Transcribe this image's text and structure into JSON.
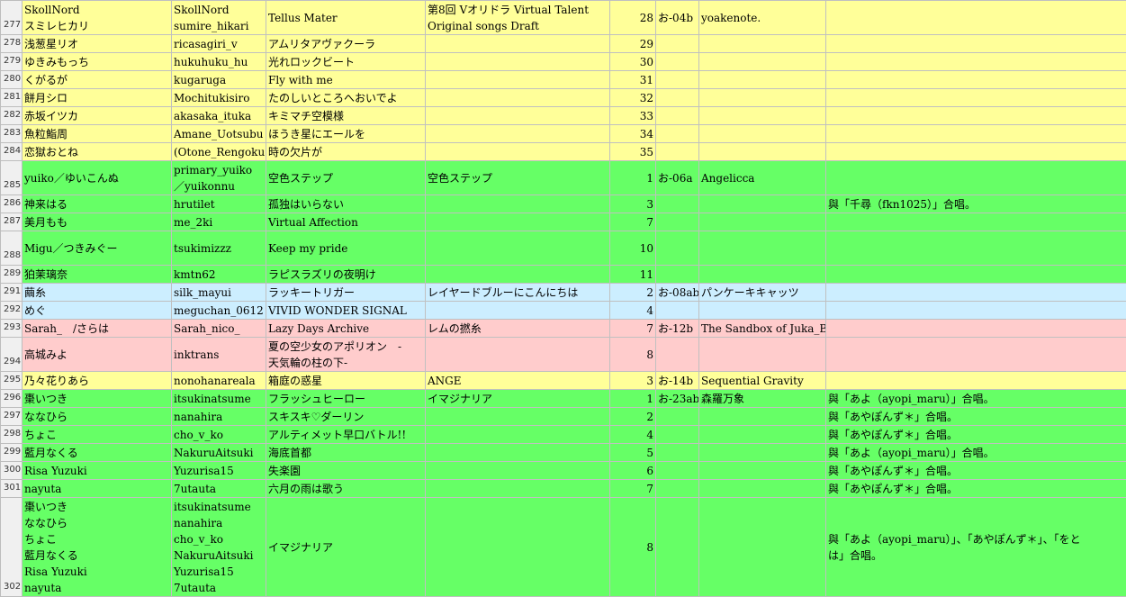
{
  "colors": {
    "yellow": "#ffff99",
    "green": "#66ff66",
    "blue": "#cceeff",
    "pink": "#ffcccc",
    "row_header": "#f0f0f0",
    "grid": "#c0c0c0"
  },
  "rows": [
    {
      "num": "277",
      "color": "yellow",
      "h": 36,
      "name": "SkollNord\nスミレヒカリ",
      "handle": "SkollNord\nsumire_hikari",
      "song": "Tellus Mater",
      "album": "第8回 Vオリドラ Virtual Talent\nOriginal songs Draft",
      "track": "28",
      "code": "お-04b",
      "circle": "yoakenote.",
      "note": ""
    },
    {
      "num": "278",
      "color": "yellow",
      "h": 18,
      "name": "浅葱星リオ",
      "handle": "ricasagiri_v",
      "song": "アムリタアヴァクーラ",
      "album": "",
      "track": "29",
      "code": "",
      "circle": "",
      "note": ""
    },
    {
      "num": "279",
      "color": "yellow",
      "h": 18,
      "name": "ゆきみもっち",
      "handle": "hukuhuku_hu",
      "song": "光れロックビート",
      "album": "",
      "track": "30",
      "code": "",
      "circle": "",
      "note": ""
    },
    {
      "num": "280",
      "color": "yellow",
      "h": 18,
      "name": "くがるが",
      "handle": "kugaruga",
      "song": "Fly with me",
      "album": "",
      "track": "31",
      "code": "",
      "circle": "",
      "note": ""
    },
    {
      "num": "281",
      "color": "yellow",
      "h": 18,
      "name": "餅月シロ",
      "handle": "Mochitukisiro",
      "song": "たのしいところへおいでよ",
      "album": "",
      "track": "32",
      "code": "",
      "circle": "",
      "note": ""
    },
    {
      "num": "282",
      "color": "yellow",
      "h": 18,
      "name": "赤坂イツカ",
      "handle": "akasaka_ituka",
      "song": "キミマチ空模様",
      "album": "",
      "track": "33",
      "code": "",
      "circle": "",
      "note": ""
    },
    {
      "num": "283",
      "color": "yellow",
      "h": 18,
      "name": "魚粒鮨周",
      "handle": "Amane_Uotsubu",
      "song": "ほうき星にエールを",
      "album": "",
      "track": "34",
      "code": "",
      "circle": "",
      "note": ""
    },
    {
      "num": "284",
      "color": "yellow",
      "h": 18,
      "name": "恋獄おとね",
      "handle": "(Otone_Rengoku)",
      "song": "時の欠片が",
      "album": "",
      "track": "35",
      "code": "",
      "circle": "",
      "note": ""
    },
    {
      "num": "285",
      "color": "green",
      "h": 36,
      "name": "yuiko／ゆいこんぬ",
      "handle": "primary_yuiko\n／yuikonnu",
      "song": "空色ステップ",
      "album": "空色ステップ",
      "track": "1",
      "code": "お-06a",
      "circle": "Angelicca",
      "note": ""
    },
    {
      "num": "286",
      "color": "green",
      "h": 18,
      "name": "神来はる",
      "handle": "hrutilet",
      "song": "孤独はいらない",
      "album": "",
      "track": "3",
      "code": "",
      "circle": "",
      "note": "與「千尋（fkn1025）」合唱。"
    },
    {
      "num": "287",
      "color": "green",
      "h": 18,
      "name": "美月もも",
      "handle": "me_2ki",
      "song": "Virtual Affection",
      "album": "",
      "track": "7",
      "code": "",
      "circle": "",
      "note": ""
    },
    {
      "num": "288",
      "color": "green",
      "h": 36,
      "name": "Migu／つきみぐー",
      "handle": "tsukimizzz",
      "song": "Keep my pride",
      "album": "",
      "track": "10",
      "code": "",
      "circle": "",
      "note": ""
    },
    {
      "num": "289",
      "color": "green",
      "h": 18,
      "name": "狛茉璃奈",
      "handle": "kmtn62",
      "song": "ラピスラズリの夜明け",
      "album": "",
      "track": "11",
      "code": "",
      "circle": "",
      "note": ""
    },
    {
      "num": "291",
      "color": "blue",
      "h": 18,
      "name": "繭糸",
      "handle": "silk_mayui",
      "song": "ラッキートリガー",
      "album": "レイヤードブルーにこんにちは",
      "track": "2",
      "code": "お-08ab",
      "circle": "パンケーキキャッツ",
      "note": ""
    },
    {
      "num": "292",
      "color": "blue",
      "h": 18,
      "name": "めぐ",
      "handle": "meguchan_0612",
      "song": "VIVID WONDER SIGNAL",
      "album": "",
      "track": "4",
      "code": "",
      "circle": "",
      "note": ""
    },
    {
      "num": "293",
      "color": "pink",
      "h": 18,
      "name": "Sarah_　/さらは",
      "handle": "Sarah_nico_",
      "song": "Lazy Days Archive",
      "album": "レムの撚糸",
      "track": "7",
      "code": "お-12b",
      "circle": "The Sandbox of Juka_Box",
      "note": ""
    },
    {
      "num": "294",
      "color": "pink",
      "h": 36,
      "name": "高城みよ",
      "handle": "inktrans",
      "song": "夏の空少女のアポリオン　-\n天気輪の柱の下-",
      "album": "",
      "track": "8",
      "code": "",
      "circle": "",
      "note": ""
    },
    {
      "num": "295",
      "color": "yellow",
      "h": 18,
      "name": "乃々花りあら",
      "handle": "nonohanareala",
      "song": "箱庭の惑星",
      "album": "ANGE",
      "track": "3",
      "code": "お-14b",
      "circle": "Sequential Gravity",
      "note": ""
    },
    {
      "num": "296",
      "color": "green",
      "h": 18,
      "name": "棗いつき",
      "handle": "itsukinatsume",
      "song": "フラッシュヒーロー",
      "album": "イマジナリア",
      "track": "1",
      "code": "お-23ab",
      "circle": "森羅万象",
      "note": "與「あよ（ayopi_maru）」合唱。"
    },
    {
      "num": "297",
      "color": "green",
      "h": 18,
      "name": "ななひら",
      "handle": "nanahira",
      "song": "スキスキ♡ダーリン",
      "album": "",
      "track": "2",
      "code": "",
      "circle": "",
      "note": "與「あやぽんず＊」合唱。"
    },
    {
      "num": "298",
      "color": "green",
      "h": 18,
      "name": "ちょこ",
      "handle": "cho_v_ko",
      "song": "アルティメット早口バトル!!",
      "album": "",
      "track": "4",
      "code": "",
      "circle": "",
      "note": "與「あやぽんず＊」合唱。"
    },
    {
      "num": "299",
      "color": "green",
      "h": 18,
      "name": "藍月なくる",
      "handle": "NakuruAitsuki",
      "song": "海底首都",
      "album": "",
      "track": "5",
      "code": "",
      "circle": "",
      "note": "與「あよ（ayopi_maru）」合唱。"
    },
    {
      "num": "300",
      "color": "green",
      "h": 18,
      "name": "Risa Yuzuki",
      "handle": "Yuzurisa15",
      "song": "失楽園",
      "album": "",
      "track": "6",
      "code": "",
      "circle": "",
      "note": "與「あやぽんず＊」合唱。"
    },
    {
      "num": "301",
      "color": "green",
      "h": 18,
      "name": "nayuta",
      "handle": "7utauta",
      "song": "六月の雨は歌う",
      "album": "",
      "track": "7",
      "code": "",
      "circle": "",
      "note": "與「あやぽんず＊」合唱。"
    },
    {
      "num": "302",
      "color": "green",
      "h": 108,
      "name": "棗いつき\nななひら\nちょこ\n藍月なくる\nRisa Yuzuki\nnayuta",
      "handle": "itsukinatsume\nnanahira\ncho_v_ko\nNakuruAitsuki\nYuzurisa15\n7utauta",
      "song": "イマジナリア",
      "album": "",
      "track": "8",
      "code": "",
      "circle": "",
      "note": "與「あよ（ayopi_maru）」、「あやぽんず＊」、「をと\nは」合唱。"
    }
  ]
}
